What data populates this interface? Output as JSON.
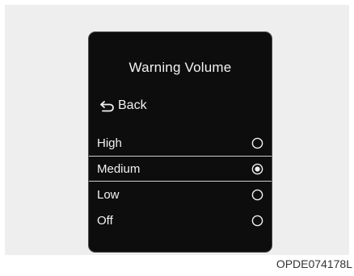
{
  "screen": {
    "title": "Warning Volume",
    "back_label": "Back",
    "back_icon": "return-arrow-icon",
    "options": [
      {
        "label": "High",
        "selected": false
      },
      {
        "label": "Medium",
        "selected": true
      },
      {
        "label": "Low",
        "selected": false
      },
      {
        "label": "Off",
        "selected": false
      }
    ]
  },
  "figure_code": "OPDE074178L",
  "colors": {
    "screen_bg": "#0d0d0d",
    "text": "#f2f2f2",
    "page_bg": "#eeeeee"
  }
}
